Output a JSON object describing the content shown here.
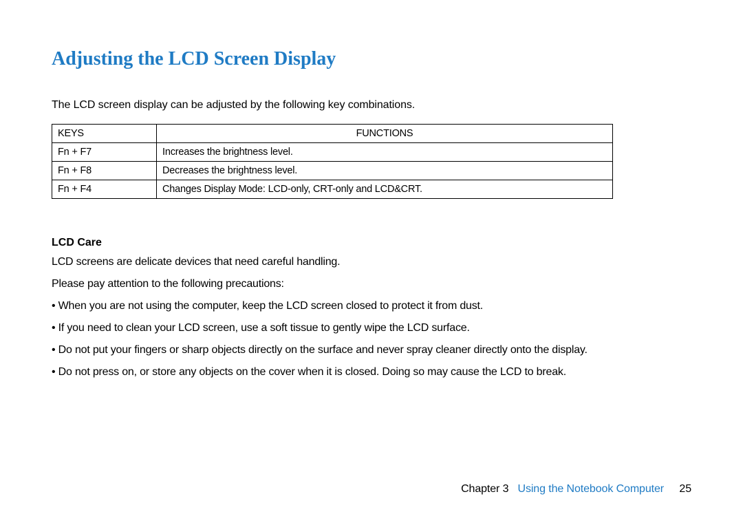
{
  "title": "Adjusting the LCD Screen Display",
  "intro": "The LCD screen display can be adjusted by the following key combinations.",
  "table": {
    "headers": {
      "keys": "KEYS",
      "functions": "FUNCTIONS"
    },
    "rows": [
      {
        "keys": "Fn + F7",
        "functions": "Increases the brightness level."
      },
      {
        "keys": "Fn + F8",
        "functions": "Decreases the brightness level."
      },
      {
        "keys": "Fn + F4",
        "functions": "Changes Display Mode: LCD-only, CRT-only and LCD&CRT."
      }
    ]
  },
  "section_heading": "LCD Care",
  "paragraphs": [
    "LCD screens are delicate devices that need careful handling.",
    "Please pay attention to the following precautions:"
  ],
  "bullets": [
    "• When you are not using the computer, keep the LCD screen closed to protect it from dust.",
    "• If you need to clean your LCD screen, use a soft tissue to gently wipe the LCD surface.",
    "• Do not put your fingers or sharp objects directly on the surface and never spray cleaner directly onto the display.",
    "• Do not press on, or store any objects on the cover when it is closed. Doing so may cause the LCD to break."
  ],
  "footer": {
    "chapter_label": "Chapter 3",
    "chapter_name": "Using the Notebook Computer",
    "page": "25"
  }
}
